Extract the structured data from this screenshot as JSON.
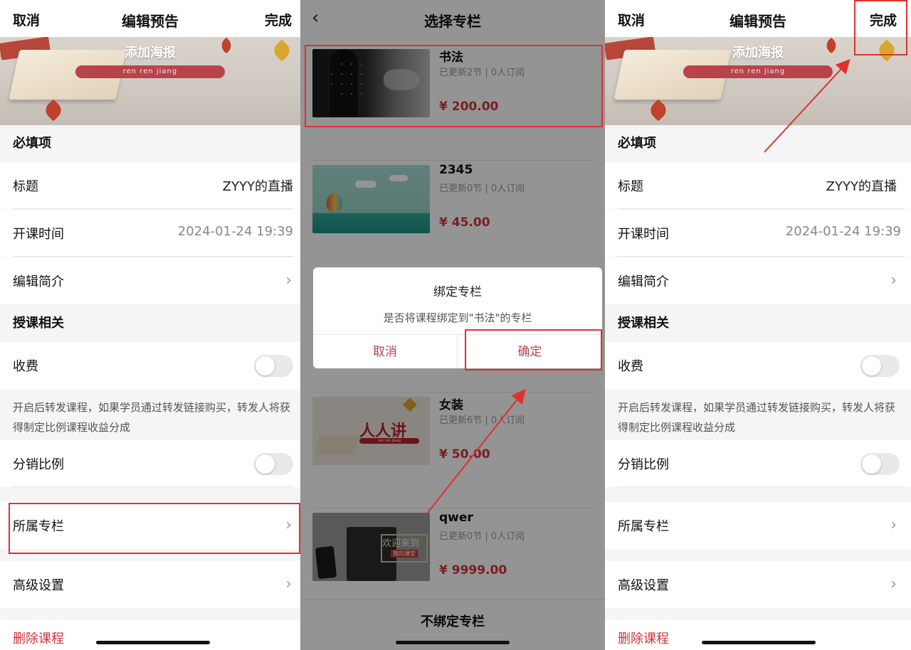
{
  "edit": {
    "cancel": "取消",
    "title": "编辑预告",
    "done": "完成",
    "poster_title": "添加海报",
    "poster_badge": "ren ren jiang",
    "required_header": "必填项",
    "title_label": "标题",
    "title_value": "ZYYY的直播",
    "time_label": "开课时间",
    "time_value": "2024-01-24 19:39",
    "intro_label": "编辑简介",
    "teaching_header": "授课相关",
    "fee_label": "收费",
    "hint": "开启后转发课程，如果学员通过转发链接购买，转发人将获得制定比例课程收益分成",
    "ratio_label": "分销比例",
    "column_label": "所属专栏",
    "advanced_label": "高级设置",
    "delete_label": "删除课程"
  },
  "select": {
    "title": "选择专栏",
    "items": [
      {
        "name": "书法",
        "meta": "已更新2节 | 0人订阅",
        "price": "¥ 200.00"
      },
      {
        "name": "2345",
        "meta": "已更新0节 | 0人订阅",
        "price": "¥ 45.00"
      },
      {
        "name": "女装",
        "meta": "已更新6节 | 0人订阅",
        "price": "¥ 50.00"
      },
      {
        "name": "qwer",
        "meta": "已更新0节 | 0人订阅",
        "price": "¥ 9999.00"
      }
    ],
    "thumb_text_3": "人人讲",
    "thumb_text_3_sub": "ren ren jiang",
    "thumb_text_4": "欢迎来到",
    "thumb_text_4_sub": "我的课堂",
    "unbind": "不绑定专栏",
    "dialog": {
      "title": "绑定专栏",
      "message": "是否将课程绑定到\"书法\"的专栏",
      "cancel": "取消",
      "confirm": "确定"
    }
  },
  "colors": {
    "accent_red": "#d0343b",
    "annotation_red": "#e0312f",
    "dialog_button": "#b9434a"
  }
}
